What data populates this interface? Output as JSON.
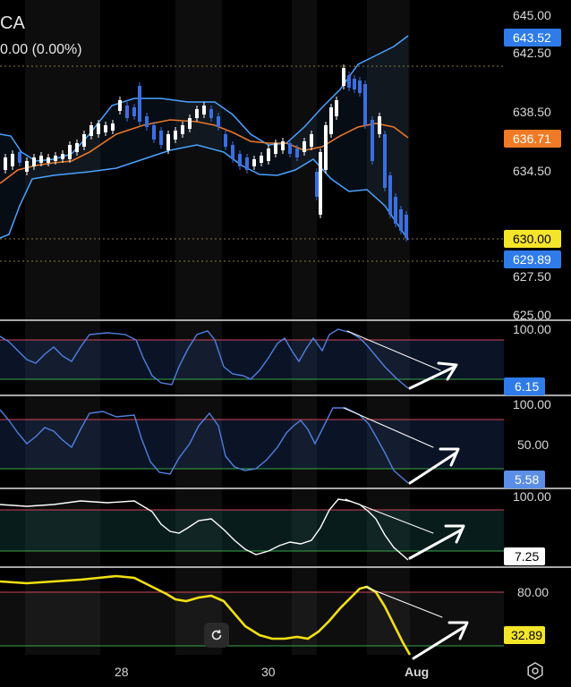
{
  "header": {
    "symbol": "CA",
    "change": "0.00 (0.00%)"
  },
  "price_axis": {
    "ticks": [
      "645.00",
      "642.50",
      "638.50",
      "634.50",
      "627.50",
      "625.00"
    ],
    "labels": {
      "ma_fast": "643.52",
      "ma_slow": "636.71",
      "last": "630.00",
      "lower": "629.89"
    }
  },
  "panes": [
    {
      "name": "oscillator-1",
      "ticks": [
        "100.00"
      ],
      "value": "6.15"
    },
    {
      "name": "oscillator-2",
      "ticks": [
        "100.00",
        "50.00"
      ],
      "value": "5.58"
    },
    {
      "name": "oscillator-3",
      "ticks": [
        "100.00"
      ],
      "value": "7.25"
    },
    {
      "name": "oscillator-4",
      "ticks": [
        "80.00"
      ],
      "value": "32.89"
    }
  ],
  "time_axis": [
    "28",
    "30",
    "Aug"
  ],
  "icons": {
    "reset": "reset-icon",
    "settings": "gear-icon"
  },
  "colors": {
    "up": "#ffffff",
    "down": "#3b6fe0",
    "bb": "#4aa3ff",
    "ma": "#e8762a",
    "osc_blue": "#4f7fe0",
    "osc_white": "#ffffff",
    "osc_yellow": "#f2e012",
    "over": "#d2455a",
    "under": "#3aa54a",
    "tag_blue": "#2f7bea",
    "tag_orange": "#f07a25",
    "tag_yellow": "#f5e52a",
    "tag_osc": "#5b8ee6"
  }
}
